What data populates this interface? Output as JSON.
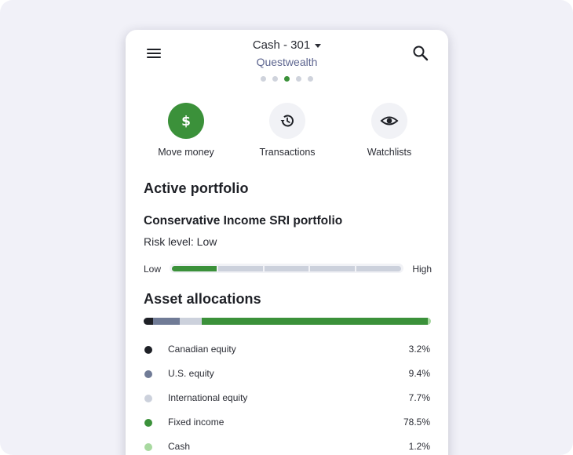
{
  "header": {
    "account": "Cash - 301",
    "organization": "Questwealth",
    "pager_dots": 5,
    "active_dot": 3
  },
  "actions": [
    {
      "label": "Move money",
      "icon": "dollar-icon"
    },
    {
      "label": "Transactions",
      "icon": "history-icon"
    },
    {
      "label": "Watchlists",
      "icon": "eye-icon"
    }
  ],
  "portfolio": {
    "section_title": "Active portfolio",
    "name": "Conservative Income SRI portfolio",
    "risk_text": "Risk level: Low",
    "risk_low_label": "Low",
    "risk_high_label": "High",
    "risk_level_fraction": 0.2
  },
  "allocations": {
    "title": "Asset allocations",
    "items": [
      {
        "name": "Canadian equity",
        "value": "3.2%",
        "percent": 3.2,
        "color": "#1e2026"
      },
      {
        "name": "U.S. equity",
        "value": "9.4%",
        "percent": 9.4,
        "color": "#707b96"
      },
      {
        "name": "International equity",
        "value": "7.7%",
        "percent": 7.7,
        "color": "#ccd1dc"
      },
      {
        "name": "Fixed income",
        "value": "78.5%",
        "percent": 78.5,
        "color": "#3b913a"
      },
      {
        "name": "Cash",
        "value": "1.2%",
        "percent": 1.2,
        "color": "#a8d9a0"
      }
    ]
  },
  "colors": {
    "accent_green": "#3b913a",
    "background": "#f1f1f8"
  }
}
